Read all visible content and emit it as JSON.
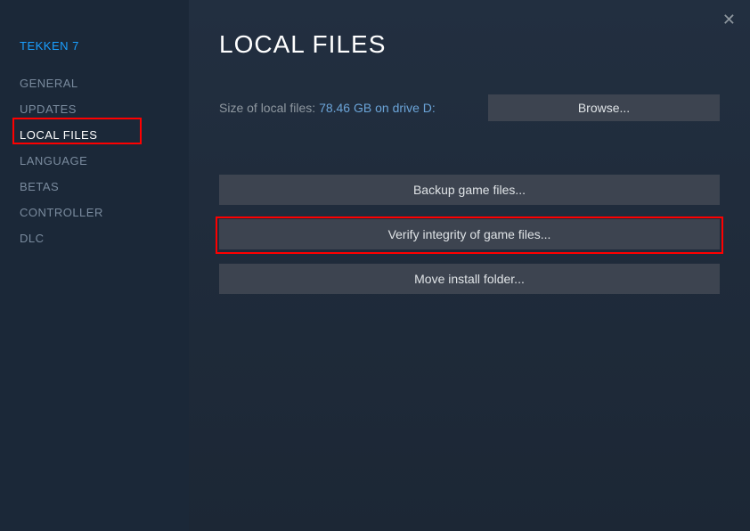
{
  "game_title": "TEKKEN 7",
  "sidebar": {
    "items": [
      {
        "label": "GENERAL"
      },
      {
        "label": "UPDATES"
      },
      {
        "label": "LOCAL FILES"
      },
      {
        "label": "LANGUAGE"
      },
      {
        "label": "BETAS"
      },
      {
        "label": "CONTROLLER"
      },
      {
        "label": "DLC"
      }
    ]
  },
  "main": {
    "title": "LOCAL FILES",
    "size_label": "Size of local files: ",
    "size_value": "78.46 GB on drive D:",
    "browse_label": "Browse...",
    "backup_label": "Backup game files...",
    "verify_label": "Verify integrity of game files...",
    "move_label": "Move install folder..."
  },
  "close_glyph": "✕"
}
